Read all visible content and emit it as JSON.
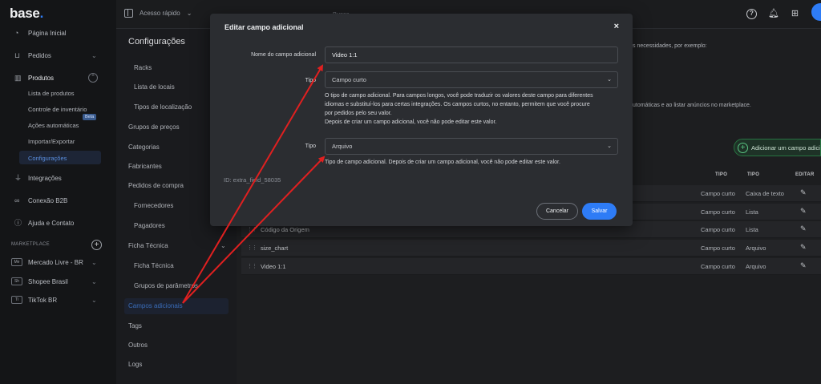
{
  "logo": {
    "text": "base",
    "dot": "."
  },
  "sidebar": {
    "items": [
      {
        "label": "Página Inicial",
        "icon": "dashboard-icon"
      },
      {
        "label": "Pedidos",
        "icon": "cart-icon"
      },
      {
        "label": "Produtos",
        "icon": "chart-icon"
      }
    ],
    "products_sub": [
      "Lista de produtos",
      "Controle de inventário",
      "Ações automáticas",
      "Importar/Exportar",
      "Configurações"
    ],
    "beta": "Beta",
    "more_items": [
      {
        "label": "Integrações",
        "icon": "plug-icon"
      },
      {
        "label": "Conexão B2B",
        "icon": "link-icon"
      },
      {
        "label": "Ajuda e Contato",
        "icon": "help-icon"
      }
    ],
    "marketplace_label": "MARKETPLACE",
    "marketplaces": [
      {
        "badge": "Me",
        "label": "Mercado Livre - BR"
      },
      {
        "badge": "Sh",
        "label": "Shopee Brasil"
      },
      {
        "badge": "Ti",
        "label": "TikTok BR"
      }
    ]
  },
  "topbar": {
    "quick_access": "Acesso rápido",
    "search_placeholder": "Busca"
  },
  "settings": {
    "title": "Configurações",
    "items": [
      {
        "label": "Racks",
        "level": 2
      },
      {
        "label": "Lista de locais",
        "level": 2
      },
      {
        "label": "Tipos de localização",
        "level": 2
      },
      {
        "label": "Grupos de preços",
        "level": 1
      },
      {
        "label": "Categorias",
        "level": 1
      },
      {
        "label": "Fabricantes",
        "level": 1
      },
      {
        "label": "Pedidos de compra",
        "level": 1
      },
      {
        "label": "Fornecedores",
        "level": 2
      },
      {
        "label": "Pagadores",
        "level": 2
      },
      {
        "label": "Ficha Técnica",
        "level": 1
      },
      {
        "label": "Ficha Técnica",
        "level": 2
      },
      {
        "label": "Grupos de parâmetros",
        "level": 2
      },
      {
        "label": "Campos adicionais",
        "level": 1
      },
      {
        "label": "Tags",
        "level": 1
      },
      {
        "label": "Outros",
        "level": 1
      },
      {
        "label": "Logs",
        "level": 1
      }
    ]
  },
  "main": {
    "desc_fragment_1": "s necessidades, por exemplo:",
    "desc_fragment_2": "utomáticas e ao listar anúncios no marketplace.",
    "add_button": "Adicionar um campo adicio",
    "columns": {
      "tipo1": "TIPO",
      "tipo2": "TIPO",
      "editar": "EDITAR"
    },
    "rows": [
      {
        "name": "",
        "type": "Campo curto",
        "input": "Caixa de texto"
      },
      {
        "name": "",
        "type": "Campo curto",
        "input": "Lista"
      },
      {
        "name": "Código da Origem",
        "type": "Campo curto",
        "input": "Lista"
      },
      {
        "name": "size_chart",
        "type": "Campo curto",
        "input": "Arquivo"
      },
      {
        "name": "Video 1:1",
        "type": "Campo curto",
        "input": "Arquivo"
      }
    ]
  },
  "modal": {
    "title": "Editar campo adicional",
    "close": "×",
    "name_label": "Nome do campo adicional",
    "name_value": "Video 1:1",
    "type_label": "Tipo",
    "type_value": "Campo curto",
    "type_help_1": "O tipo de campo adicional. Para campos longos, você pode traduzir os valores deste campo para diferentes",
    "type_help_2": "idiomas e substituí-los para certas integrações. Os campos curtos, no entanto, permitem que você procure",
    "type_help_3": "por pedidos pelo seu valor.",
    "type_help_4": "Depois de criar um campo adicional, você não pode editar este valor.",
    "input_label": "Tipo",
    "input_value": "Arquivo",
    "input_help": "Tipo de campo adicional. Depois de criar um campo adicional, você não pode editar este valor.",
    "id_text": "ID: extra_field_58035",
    "cancel": "Cancelar",
    "save": "Salvar"
  },
  "colors": {
    "accent": "#2e7cf6",
    "annotation": "#e02020",
    "success": "#5fd08a"
  }
}
